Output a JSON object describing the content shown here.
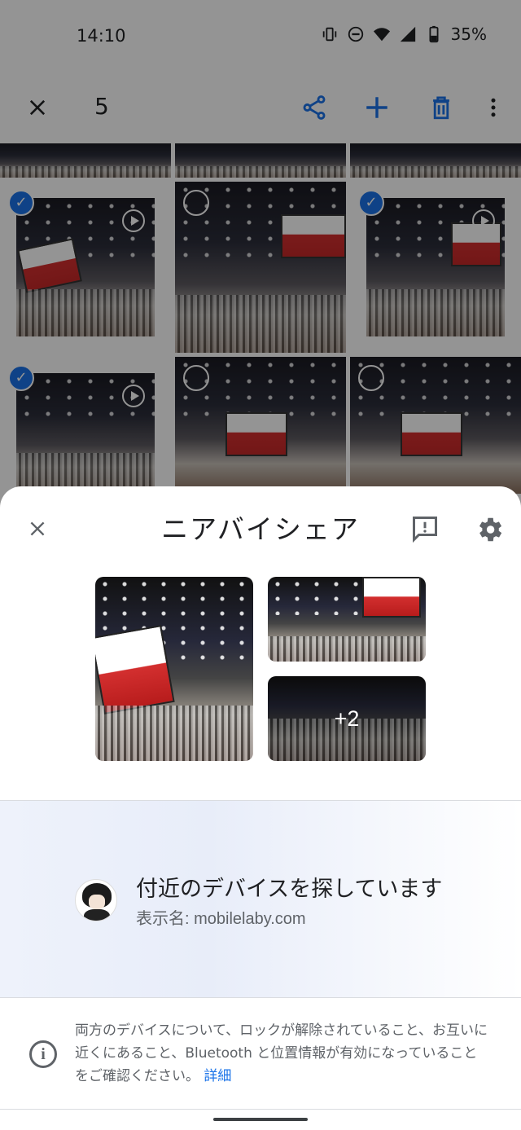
{
  "status_bar": {
    "time": "14:10",
    "battery": "35%",
    "icons": [
      "vibrate-icon",
      "dnd-icon",
      "wifi-icon",
      "signal-icon",
      "battery-icon"
    ]
  },
  "app_bar": {
    "close_icon": "close-icon",
    "selected_count": "5",
    "actions": [
      "share-icon",
      "add-icon",
      "delete-icon",
      "more-vert-icon"
    ]
  },
  "colors": {
    "accent": "#1a73e8",
    "text_primary": "#202124",
    "text_secondary": "#5f6368",
    "scrim": "rgba(0,0,0,0.42)"
  },
  "sheet": {
    "title": "ニアバイシェア",
    "more_count": "+2",
    "search": {
      "title": "付近のデバイスを探しています",
      "subtitle": "表示名: mobilelaby.com"
    },
    "info": {
      "text": "両方のデバイスについて、ロックが解除されていること、お互いに近くにあること、Bluetooth と位置情報が有効になっていることをご確認ください。",
      "link": "詳細"
    }
  }
}
